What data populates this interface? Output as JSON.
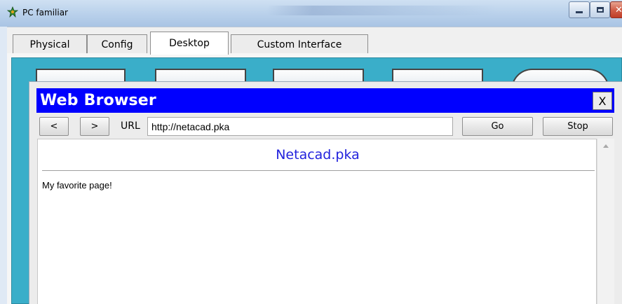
{
  "window": {
    "title": "PC familiar"
  },
  "tabs": [
    {
      "label": "Physical"
    },
    {
      "label": "Config"
    },
    {
      "label": "Desktop"
    },
    {
      "label": "Custom Interface"
    }
  ],
  "browser": {
    "title": "Web Browser",
    "close_label": "X",
    "back_label": "<",
    "forward_label": ">",
    "url_label": "URL",
    "url_value": "http://netacad.pka",
    "go_label": "Go",
    "stop_label": "Stop",
    "page": {
      "heading": "Netacad.pka",
      "body": "My favorite page!"
    }
  },
  "colors": {
    "browser_titlebar": "#0000ff",
    "desktop_background": "#3aaec9",
    "page_heading": "#2222dd"
  },
  "icons": [
    "app-icon",
    "minimize-icon",
    "maximize-icon",
    "close-icon",
    "scroll-up-icon"
  ]
}
